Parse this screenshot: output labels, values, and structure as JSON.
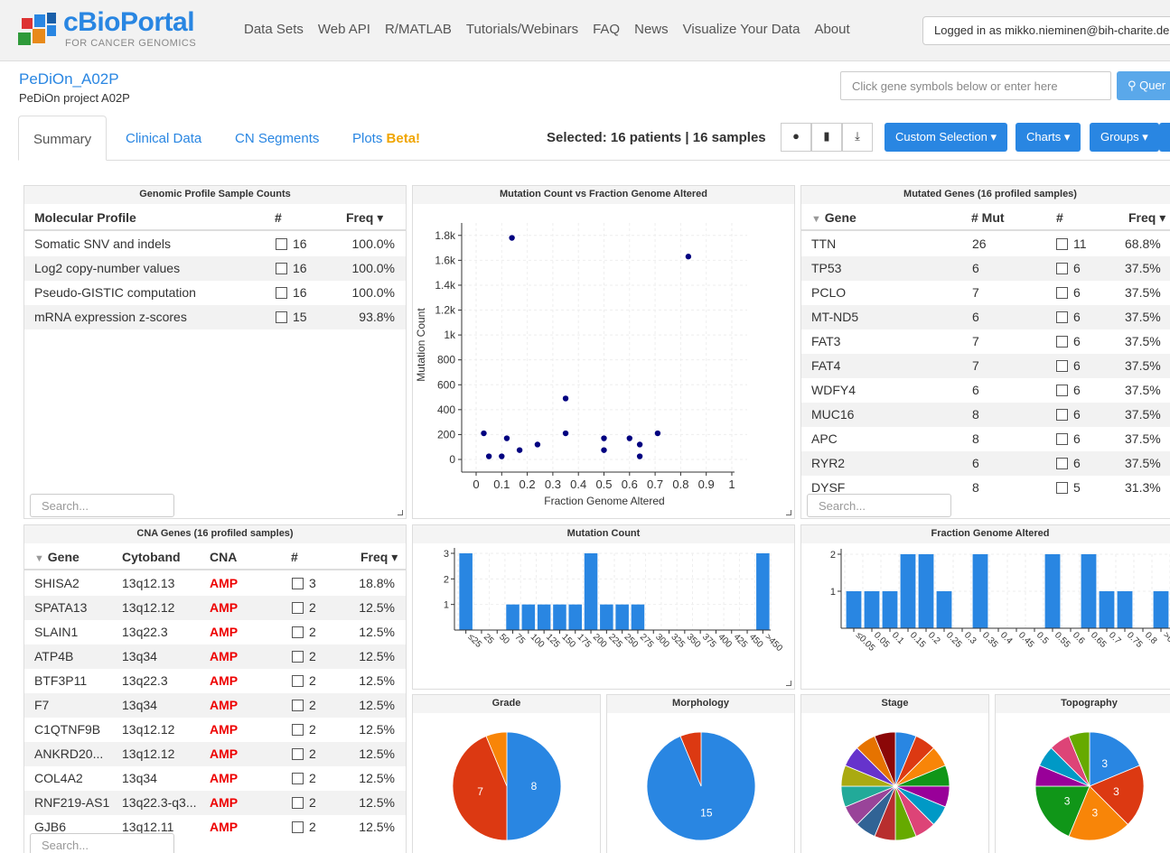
{
  "header": {
    "logo_text": "cBioPortal",
    "logo_sub": "FOR CANCER GENOMICS",
    "nav": [
      "Data Sets",
      "Web API",
      "R/MATLAB",
      "Tutorials/Webinars",
      "FAQ",
      "News",
      "Visualize Your Data",
      "About"
    ],
    "login": "Logged in as mikko.nieminen@bih-charite.de"
  },
  "study": {
    "title": "PeDiOn_A02P",
    "subtitle": "PeDiOn project A02P"
  },
  "gene_search": {
    "placeholder": "Click gene symbols below or enter here",
    "query_label": "Quer"
  },
  "tabs": {
    "summary": "Summary",
    "clinical": "Clinical Data",
    "cn": "CN Segments",
    "plots": "Plots",
    "beta": "Beta!"
  },
  "selection": {
    "text": "Selected: 16 patients | 16 samples"
  },
  "buttons": {
    "custom": "Custom Selection ▾",
    "charts": "Charts ▾",
    "groups": "Groups ▾"
  },
  "genomic_profile": {
    "title": "Genomic Profile Sample Counts",
    "headers": [
      "Molecular Profile",
      "#",
      "Freq ▾"
    ],
    "rows": [
      {
        "profile": "Somatic SNV and indels",
        "count": "16",
        "freq": "100.0%"
      },
      {
        "profile": "Log2 copy-number values",
        "count": "16",
        "freq": "100.0%"
      },
      {
        "profile": "Pseudo-GISTIC computation",
        "count": "16",
        "freq": "100.0%"
      },
      {
        "profile": "mRNA expression z-scores",
        "count": "15",
        "freq": "93.8%"
      }
    ],
    "search_placeholder": "Search..."
  },
  "scatter": {
    "title": "Mutation Count vs Fraction Genome Altered",
    "xlabel": "Fraction Genome Altered",
    "ylabel": "Mutation Count",
    "xticks": [
      "0",
      "0.1",
      "0.2",
      "0.3",
      "0.4",
      "0.5",
      "0.6",
      "0.7",
      "0.8",
      "0.9",
      "1"
    ],
    "yticks": [
      "0",
      "200",
      "400",
      "600",
      "800",
      "1k",
      "1.2k",
      "1.4k",
      "1.6k",
      "1.8k"
    ]
  },
  "mutated_genes": {
    "title": "Mutated Genes (16 profiled samples)",
    "headers": [
      "Gene",
      "# Mut",
      "#",
      "Freq ▾"
    ],
    "rows": [
      {
        "gene": "TTN",
        "mut": "26",
        "count": "11",
        "freq": "68.8%"
      },
      {
        "gene": "TP53",
        "mut": "6",
        "count": "6",
        "freq": "37.5%"
      },
      {
        "gene": "PCLO",
        "mut": "7",
        "count": "6",
        "freq": "37.5%"
      },
      {
        "gene": "MT-ND5",
        "mut": "6",
        "count": "6",
        "freq": "37.5%"
      },
      {
        "gene": "FAT3",
        "mut": "7",
        "count": "6",
        "freq": "37.5%"
      },
      {
        "gene": "FAT4",
        "mut": "7",
        "count": "6",
        "freq": "37.5%"
      },
      {
        "gene": "WDFY4",
        "mut": "6",
        "count": "6",
        "freq": "37.5%"
      },
      {
        "gene": "MUC16",
        "mut": "8",
        "count": "6",
        "freq": "37.5%"
      },
      {
        "gene": "APC",
        "mut": "8",
        "count": "6",
        "freq": "37.5%"
      },
      {
        "gene": "RYR2",
        "mut": "6",
        "count": "6",
        "freq": "37.5%"
      },
      {
        "gene": "DYSF",
        "mut": "8",
        "count": "5",
        "freq": "31.3%"
      }
    ],
    "search_placeholder": "Search..."
  },
  "cna_genes": {
    "title": "CNA Genes (16 profiled samples)",
    "headers": [
      "Gene",
      "Cytoband",
      "CNA",
      "#",
      "Freq ▾"
    ],
    "rows": [
      {
        "gene": "SHISA2",
        "cytoband": "13q12.13",
        "cna": "AMP",
        "count": "3",
        "freq": "18.8%"
      },
      {
        "gene": "SPATA13",
        "cytoband": "13q12.12",
        "cna": "AMP",
        "count": "2",
        "freq": "12.5%"
      },
      {
        "gene": "SLAIN1",
        "cytoband": "13q22.3",
        "cna": "AMP",
        "count": "2",
        "freq": "12.5%"
      },
      {
        "gene": "ATP4B",
        "cytoband": "13q34",
        "cna": "AMP",
        "count": "2",
        "freq": "12.5%"
      },
      {
        "gene": "BTF3P11",
        "cytoband": "13q22.3",
        "cna": "AMP",
        "count": "2",
        "freq": "12.5%"
      },
      {
        "gene": "F7",
        "cytoband": "13q34",
        "cna": "AMP",
        "count": "2",
        "freq": "12.5%"
      },
      {
        "gene": "C1QTNF9B",
        "cytoband": "13q12.12",
        "cna": "AMP",
        "count": "2",
        "freq": "12.5%"
      },
      {
        "gene": "ANKRD20...",
        "cytoband": "13q12.12",
        "cna": "AMP",
        "count": "2",
        "freq": "12.5%"
      },
      {
        "gene": "COL4A2",
        "cytoband": "13q34",
        "cna": "AMP",
        "count": "2",
        "freq": "12.5%"
      },
      {
        "gene": "RNF219-AS1",
        "cytoband": "13q22.3-q3...",
        "cna": "AMP",
        "count": "2",
        "freq": "12.5%"
      },
      {
        "gene": "GJB6",
        "cytoband": "13q12.11",
        "cna": "AMP",
        "count": "2",
        "freq": "12.5%"
      }
    ],
    "search_placeholder": "Search..."
  },
  "mutation_count_chart": {
    "title": "Mutation Count",
    "categories": [
      "≤25",
      "25",
      "50",
      "75",
      "100",
      "125",
      "150",
      "175",
      "200",
      "225",
      "250",
      "275",
      "300",
      "325",
      "350",
      "375",
      "400",
      "425",
      "450",
      ">450"
    ],
    "values": [
      3,
      0,
      0,
      1,
      1,
      1,
      1,
      1,
      3,
      1,
      1,
      1,
      0,
      0,
      0,
      0,
      0,
      0,
      0,
      3
    ],
    "yticks": [
      "1",
      "2",
      "3"
    ]
  },
  "fga_chart": {
    "title": "Fraction Genome Altered",
    "categories": [
      "≤0.05",
      "0.05",
      "0.1",
      "0.15",
      "0.2",
      "0.25",
      "0.3",
      "0.35",
      "0.4",
      "0.45",
      "0.5",
      "0.55",
      "0.6",
      "0.65",
      "0.7",
      "0.75",
      "0.8",
      ">0.8"
    ],
    "values": [
      1,
      1,
      1,
      2,
      2,
      1,
      0,
      2,
      0,
      0,
      0,
      2,
      0,
      2,
      1,
      1,
      0,
      1
    ],
    "yticks": [
      "1",
      "2"
    ]
  },
  "pies": {
    "grade": {
      "title": "Grade",
      "labels": [
        "8",
        "7"
      ]
    },
    "morphology": {
      "title": "Morphology",
      "labels": [
        "15"
      ]
    },
    "stage": {
      "title": "Stage"
    },
    "topography": {
      "title": "Topography",
      "labels": [
        "3",
        "3",
        "3",
        "3"
      ]
    }
  },
  "chart_data": [
    {
      "type": "scatter",
      "title": "Mutation Count vs Fraction Genome Altered",
      "xlabel": "Fraction Genome Altered",
      "ylabel": "Mutation Count",
      "xlim": [
        0,
        1
      ],
      "ylim": [
        0,
        1800
      ],
      "points": [
        {
          "x": 0.03,
          "y": 210
        },
        {
          "x": 0.05,
          "y": 25
        },
        {
          "x": 0.1,
          "y": 25
        },
        {
          "x": 0.12,
          "y": 170
        },
        {
          "x": 0.14,
          "y": 1780
        },
        {
          "x": 0.17,
          "y": 75
        },
        {
          "x": 0.24,
          "y": 120
        },
        {
          "x": 0.35,
          "y": 490
        },
        {
          "x": 0.35,
          "y": 210
        },
        {
          "x": 0.5,
          "y": 170
        },
        {
          "x": 0.5,
          "y": 75
        },
        {
          "x": 0.6,
          "y": 170
        },
        {
          "x": 0.64,
          "y": 120
        },
        {
          "x": 0.64,
          "y": 25
        },
        {
          "x": 0.71,
          "y": 210
        },
        {
          "x": 0.83,
          "y": 1630
        }
      ]
    },
    {
      "type": "bar",
      "title": "Mutation Count",
      "categories": [
        "≤25",
        "25",
        "50",
        "75",
        "100",
        "125",
        "150",
        "175",
        "200",
        "225",
        "250",
        "275",
        "300",
        "325",
        "350",
        "375",
        "400",
        "425",
        "450",
        ">450"
      ],
      "values": [
        3,
        0,
        0,
        1,
        1,
        1,
        1,
        1,
        3,
        1,
        1,
        1,
        0,
        0,
        0,
        0,
        0,
        0,
        0,
        3
      ],
      "ylim": [
        0,
        3
      ]
    },
    {
      "type": "bar",
      "title": "Fraction Genome Altered",
      "categories": [
        "≤0.05",
        "0.05",
        "0.1",
        "0.15",
        "0.2",
        "0.25",
        "0.3",
        "0.35",
        "0.4",
        "0.45",
        "0.5",
        "0.55",
        "0.6",
        "0.65",
        "0.7",
        "0.75",
        "0.8",
        ">0.8"
      ],
      "values": [
        1,
        1,
        1,
        2,
        2,
        1,
        0,
        2,
        0,
        0,
        0,
        2,
        0,
        2,
        1,
        1,
        0,
        1
      ],
      "ylim": [
        0,
        2
      ]
    },
    {
      "type": "pie",
      "title": "Grade",
      "values": [
        8,
        7,
        1
      ],
      "colors": [
        "#2986e2",
        "#dc3912",
        "#f88508"
      ]
    },
    {
      "type": "pie",
      "title": "Morphology",
      "values": [
        15,
        1
      ],
      "colors": [
        "#2986e2",
        "#dc3912"
      ]
    },
    {
      "type": "pie",
      "title": "Stage",
      "values": [
        1,
        1,
        1,
        1,
        1,
        1,
        1,
        1,
        1,
        1,
        1,
        1,
        1,
        1,
        1,
        1
      ],
      "colors": [
        "#2986e2",
        "#dc3912",
        "#f88508",
        "#109618",
        "#990099",
        "#0099c6",
        "#dd4477",
        "#66aa00",
        "#b82e2e",
        "#316395",
        "#994499",
        "#22aa99",
        "#aaaa11",
        "#6633cc",
        "#e67300",
        "#8b0707"
      ]
    },
    {
      "type": "pie",
      "title": "Topography",
      "values": [
        3,
        3,
        3,
        3,
        1,
        1,
        1,
        1
      ],
      "colors": [
        "#2986e2",
        "#dc3912",
        "#f88508",
        "#109618",
        "#990099",
        "#0099c6",
        "#dd4477",
        "#66aa00"
      ]
    }
  ],
  "colors": {
    "accent": "#2986e2",
    "dot": "#000080",
    "amp": "#e00000"
  }
}
